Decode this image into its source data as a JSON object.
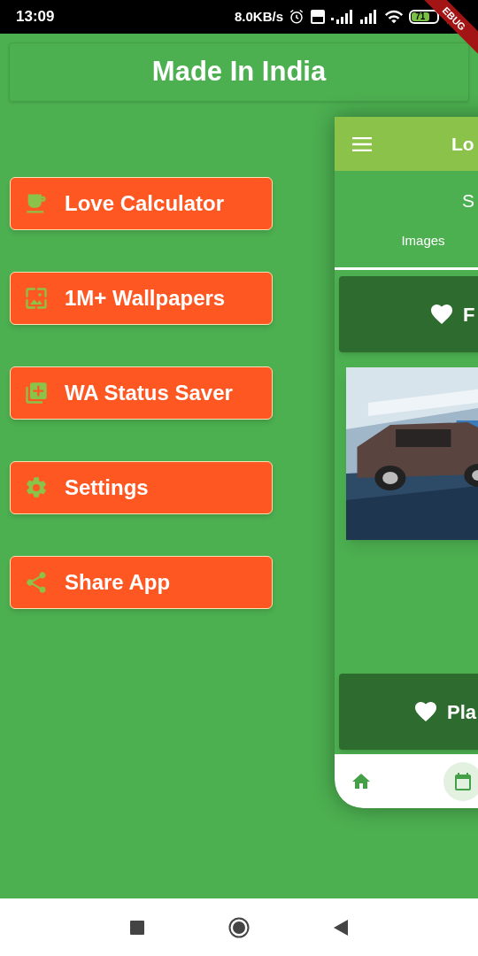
{
  "status_bar": {
    "time": "13:09",
    "speed": "8.0KB/s",
    "battery": "71"
  },
  "debug_banner": "EBUG",
  "header": {
    "title": "Made In India"
  },
  "menu": [
    {
      "label": "Love Calculator",
      "kind": "cup"
    },
    {
      "label": "1M+ Wallpapers",
      "kind": "wallpaper"
    },
    {
      "label": "WA Status Saver",
      "kind": "library"
    },
    {
      "label": "Settings",
      "kind": "settings"
    },
    {
      "label": "Share App",
      "kind": "share"
    }
  ],
  "preview": {
    "title": "Lo",
    "heading": "S",
    "tabs": [
      {
        "label": "Images",
        "selected": true
      }
    ],
    "cards": [
      {
        "label": "F"
      },
      {
        "label": "Pla"
      }
    ],
    "bottom_nav": [
      {
        "kind": "home",
        "selected": false
      },
      {
        "kind": "calendar",
        "selected": true
      }
    ]
  }
}
